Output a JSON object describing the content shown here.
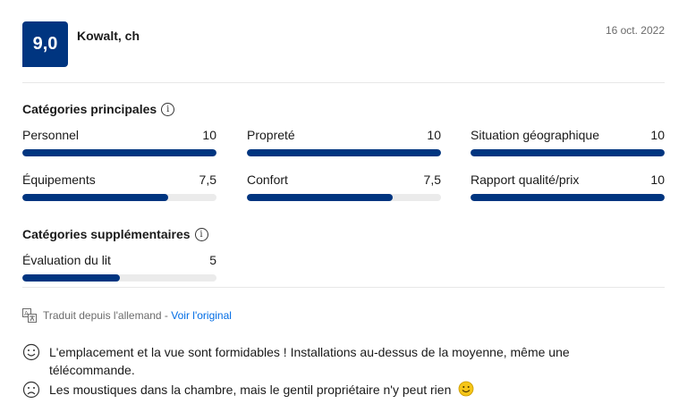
{
  "review": {
    "score": "9,0",
    "reviewer_name": "Kowalt, ch",
    "date": "16 oct. 2022"
  },
  "main_categories": {
    "title": "Catégories principales",
    "items": [
      {
        "label": "Personnel",
        "value": "10",
        "fraction": 1.0
      },
      {
        "label": "Propreté",
        "value": "10",
        "fraction": 1.0
      },
      {
        "label": "Situation géographique",
        "value": "10",
        "fraction": 1.0
      },
      {
        "label": "Équipements",
        "value": "7,5",
        "fraction": 0.75
      },
      {
        "label": "Confort",
        "value": "7,5",
        "fraction": 0.75
      },
      {
        "label": "Rapport qualité/prix",
        "value": "10",
        "fraction": 1.0
      }
    ]
  },
  "extra_categories": {
    "title": "Catégories supplémentaires",
    "items": [
      {
        "label": "Évaluation du lit",
        "value": "5",
        "fraction": 0.5
      }
    ]
  },
  "translation": {
    "note": "Traduit depuis l'allemand",
    "separator": " - ",
    "link": "Voir l'original"
  },
  "comments": {
    "positive": "L'emplacement et la vue sont formidables ! Installations au-dessus de la moyenne, même une télécommande.",
    "negative": "Les moustiques dans la chambre, mais le gentil propriétaire n'y peut rien"
  },
  "colors": {
    "brand": "#003580",
    "track": "#ebebeb",
    "link": "#006ce4",
    "emoji_yellow": "#f5c518"
  },
  "icons": [
    "info-icon",
    "translate-icon",
    "smiley-happy-icon",
    "smiley-sad-icon",
    "smiley-emoji-icon"
  ]
}
